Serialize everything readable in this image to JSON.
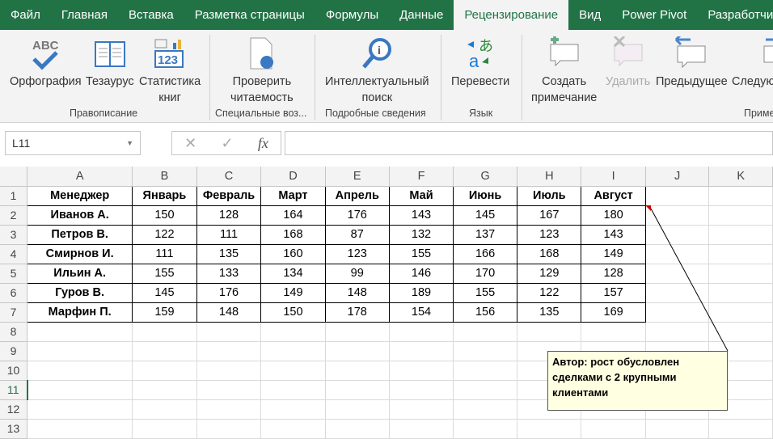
{
  "tabs": [
    "Файл",
    "Главная",
    "Вставка",
    "Разметка страницы",
    "Формулы",
    "Данные",
    "Рецензирование",
    "Вид",
    "Power Pivot",
    "Разработчик"
  ],
  "ribbon": {
    "spelling": "Орфография",
    "thesaurus": "Тезаурус",
    "stats1": "Статистика",
    "stats2": "книг",
    "check1": "Проверить",
    "check2": "читаемость",
    "smart1": "Интеллектуальный",
    "smart2": "поиск",
    "translate": "Перевести",
    "newc1": "Создать",
    "newc2": "примечание",
    "delete": "Удалить",
    "prev": "Предыдущее",
    "next": "Следующее",
    "groups": {
      "proofing": "Правописание",
      "access": "Специальные воз...",
      "insights": "Подробные сведения",
      "language": "Язык",
      "comments": "Примечания"
    }
  },
  "formula_bar": {
    "name_box": "L11",
    "fx": "fx",
    "cancel": "✕",
    "enter": "✓",
    "value": ""
  },
  "columns": [
    "A",
    "B",
    "C",
    "D",
    "E",
    "F",
    "G",
    "H",
    "I",
    "J",
    "K"
  ],
  "header_row": [
    "Менеджер",
    "Январь",
    "Февраль",
    "Март",
    "Апрель",
    "Май",
    "Июнь",
    "Июль",
    "Август"
  ],
  "rows": [
    [
      "Иванов А.",
      "150",
      "128",
      "164",
      "176",
      "143",
      "145",
      "167",
      "180"
    ],
    [
      "Петров В.",
      "122",
      "111",
      "168",
      "87",
      "132",
      "137",
      "123",
      "143"
    ],
    [
      "Смирнов И.",
      "111",
      "135",
      "160",
      "123",
      "155",
      "166",
      "168",
      "149"
    ],
    [
      "Ильин А.",
      "155",
      "133",
      "134",
      "99",
      "146",
      "170",
      "129",
      "128"
    ],
    [
      "Гуров В.",
      "145",
      "176",
      "149",
      "148",
      "189",
      "155",
      "122",
      "157"
    ],
    [
      "Марфин П.",
      "159",
      "148",
      "150",
      "178",
      "154",
      "156",
      "135",
      "169"
    ]
  ],
  "row_numbers": [
    "1",
    "2",
    "3",
    "4",
    "5",
    "6",
    "7",
    "8",
    "9",
    "10",
    "11",
    "12",
    "13"
  ],
  "comment": "Автор: рост обусловлен сделками с 2 крупными клиентами",
  "accent": "#217346"
}
